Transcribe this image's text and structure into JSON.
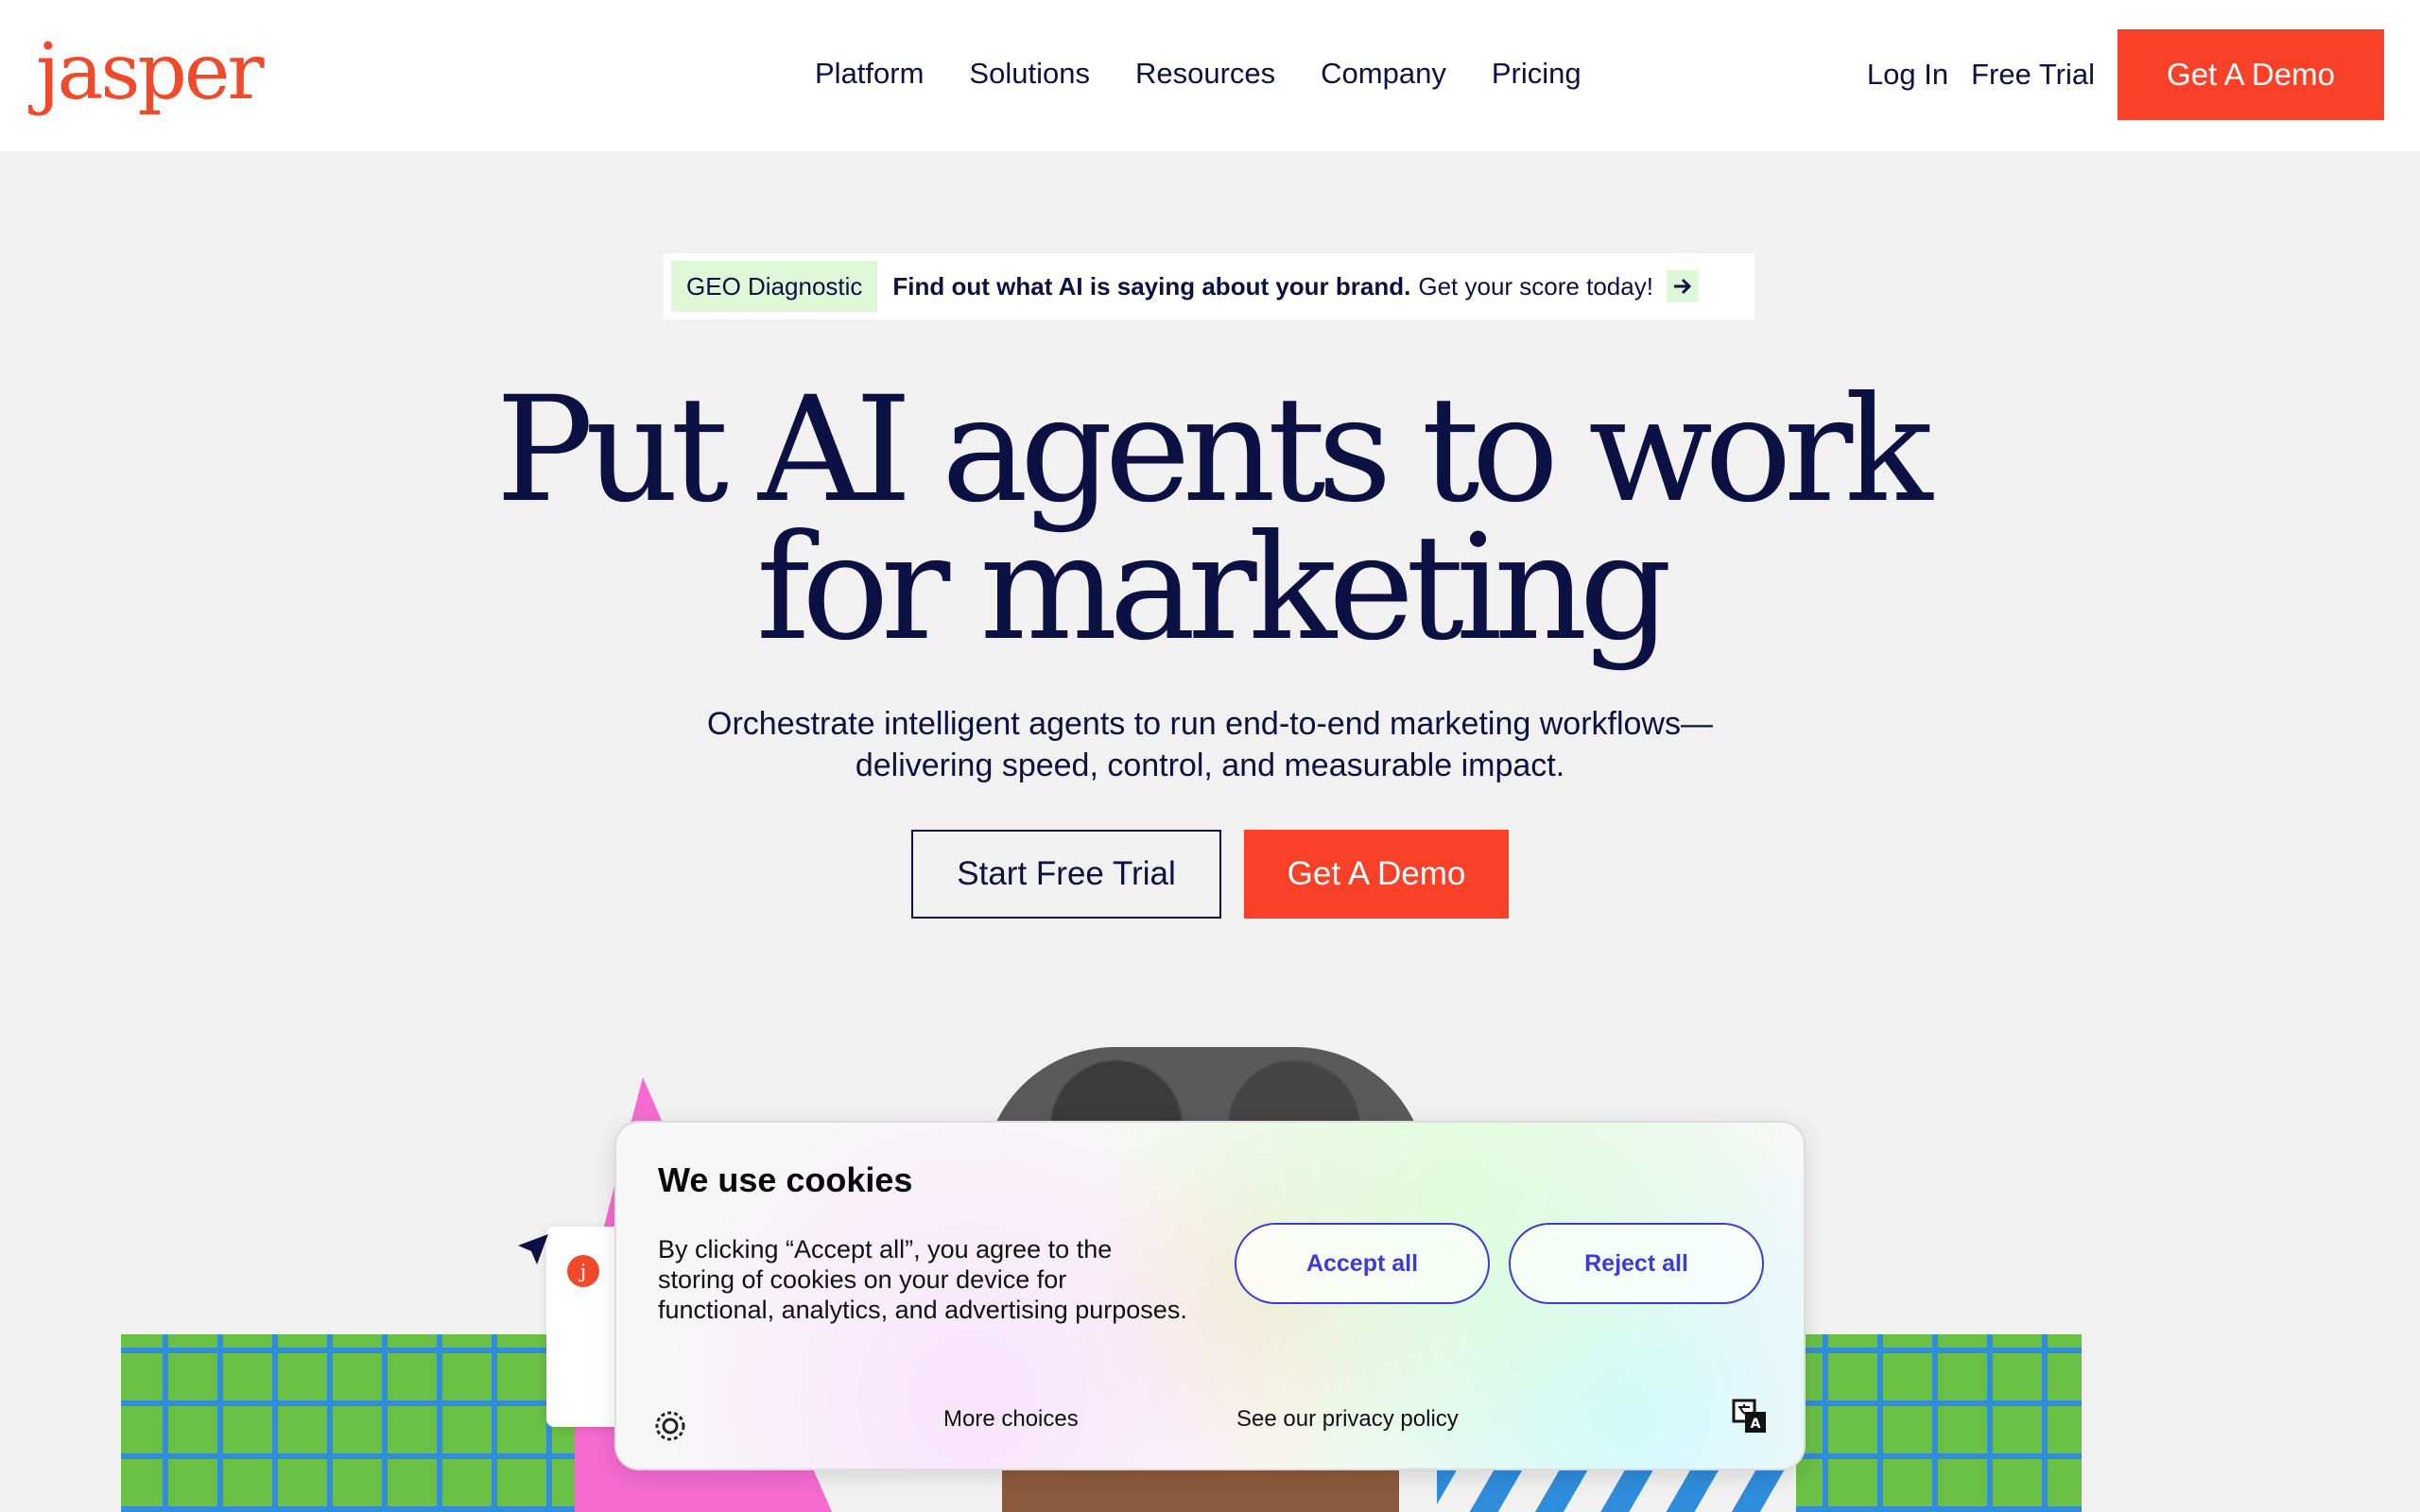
{
  "nav": {
    "logo": "jasper",
    "menu": [
      "Platform",
      "Solutions",
      "Resources",
      "Company",
      "Pricing"
    ],
    "login": "Log In",
    "free_trial": "Free Trial",
    "demo": "Get A Demo"
  },
  "banner": {
    "tag": "GEO Diagnostic",
    "bold": "Find out what AI is saying about your brand.",
    "rest": "Get your score today!"
  },
  "hero": {
    "line1": "Put AI agents to work",
    "line2": "for marketing",
    "subtitle_line1": "Orchestrate intelligent agents to run end-to-end marketing workflows—",
    "subtitle_line2": "delivering speed, control, and measurable impact.",
    "cta_trial": "Start Free Trial",
    "cta_demo": "Get A Demo"
  },
  "illustration": {
    "card_badge": "j"
  },
  "cookie": {
    "title": "We use cookies",
    "body": "By clicking “Accept all”, you agree to the storing of cookies on your device for functional, analytics, and advertising purposes.",
    "accept": "Accept all",
    "reject": "Reject all",
    "more": "More choices",
    "policy": "See our privacy policy"
  },
  "colors": {
    "brand": "#f9412a",
    "navy": "#0d1042",
    "cookie_button": "#3d3bd6"
  }
}
